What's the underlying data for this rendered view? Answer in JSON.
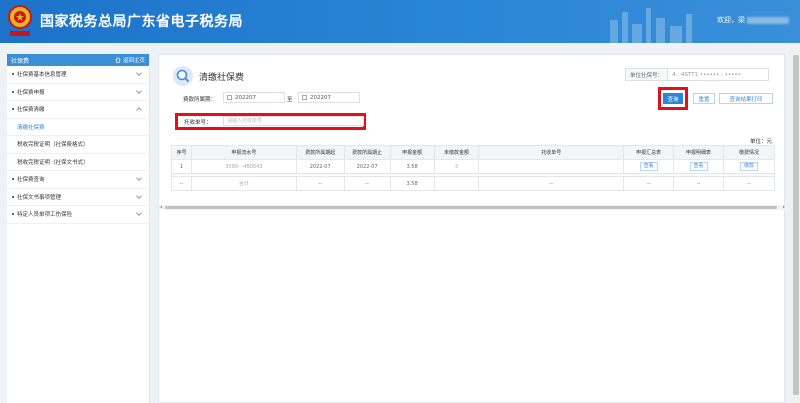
{
  "header": {
    "title": "国家税务总局广东省电子税务局",
    "welcome": "欢迎，梁",
    "emblem_text": "中国税务"
  },
  "sidebar": {
    "title": "社保费",
    "home_label": "返回主页",
    "items": [
      {
        "label": "社保费基本信息管理",
        "type": "group"
      },
      {
        "label": "社保费申报",
        "type": "group"
      },
      {
        "label": "社保费清缴",
        "type": "group"
      },
      {
        "label": "清缴社保费",
        "type": "sub",
        "active": true
      },
      {
        "label": "税收完税证明（社保费格式）",
        "type": "sub"
      },
      {
        "label": "税收完税证明（社保文书式）",
        "type": "sub"
      },
      {
        "label": "社保费查询",
        "type": "group"
      },
      {
        "label": "社保文书事项管理",
        "type": "group"
      },
      {
        "label": "特定人员单项工伤保险",
        "type": "group"
      }
    ]
  },
  "main": {
    "title": "清缴社保费",
    "unit_no_label": "单位社保号：",
    "unit_no_value": "4:    :4STT1  ••••••  :  •••••",
    "period_label": "费款所属期：",
    "period_from": "202207",
    "period_to_sep": "至",
    "period_to": "202207",
    "tuo_label": "托收单号：",
    "tuo_placeholder": "请输入托收单号",
    "btn_query": "查询",
    "btn_reset": "重置",
    "btn_print": "查询结果打印",
    "unit_yuan": "单位：元"
  },
  "table": {
    "headers": [
      "序号",
      "申报流水号",
      "费款所属期起",
      "费款所属期止",
      "申报金额",
      "未缴款金额",
      "托收单号",
      "申报汇总表",
      "申报明细表",
      "缴费情况"
    ],
    "rows": [
      {
        "seq": "1",
        "flow_no": "3000-          -4B0643",
        "from": "2022-07",
        "to": "2022-07",
        "amount": "3.58",
        "unpaid": "3",
        "tuo_no": "",
        "summary": "查看",
        "detail": "查看",
        "pay": "缴款"
      }
    ],
    "total": {
      "seq": "--",
      "label": "合计",
      "from": "--",
      "to": "--",
      "amount": "3.58",
      "unpaid": "",
      "tuo_no": "--",
      "summary": "--",
      "detail": "--",
      "pay": "--"
    }
  },
  "colors": {
    "header_bg": "#2a86d8",
    "accent": "#3a8fd8",
    "highlight": "#e3101c"
  }
}
